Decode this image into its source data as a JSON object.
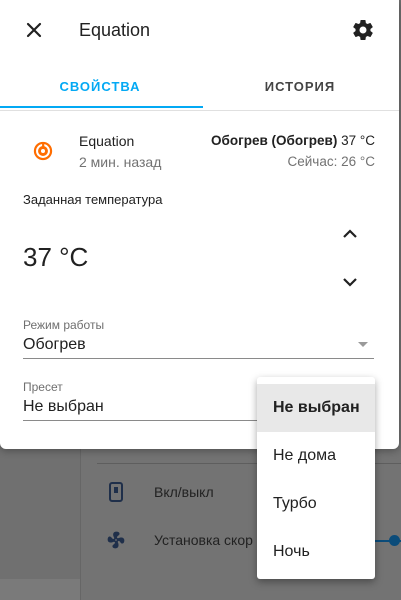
{
  "dialog": {
    "title": "Equation",
    "tabs": [
      {
        "label": "СВОЙСТВА",
        "active": true
      },
      {
        "label": "ИСТОРИЯ",
        "active": false
      }
    ]
  },
  "entity": {
    "name": "Equation",
    "last_changed": "2 мин. назад",
    "state_bold": "Обогрев (Обогрев)",
    "state_target": " 37 °C",
    "current": "Сейчас: 26 °C"
  },
  "target_temperature": {
    "label": "Заданная температура",
    "value": "37 °C"
  },
  "mode_field": {
    "label": "Режим работы",
    "value": "Обогрев"
  },
  "preset_field": {
    "label": "Пресет",
    "value": "Не выбран"
  },
  "preset_menu": {
    "items": [
      "Не выбран",
      "Не дома",
      "Турбо",
      "Ночь"
    ],
    "selected": "Не выбран"
  },
  "background": {
    "rows": [
      {
        "label": "Вкл/выкл",
        "icon": "power-switch-icon"
      },
      {
        "label": "Установка скор",
        "icon": "fan-icon"
      }
    ]
  },
  "colors": {
    "accent": "#03a9f4",
    "entity_icon": "#ff6d00",
    "slider": "#0b4c7a"
  }
}
